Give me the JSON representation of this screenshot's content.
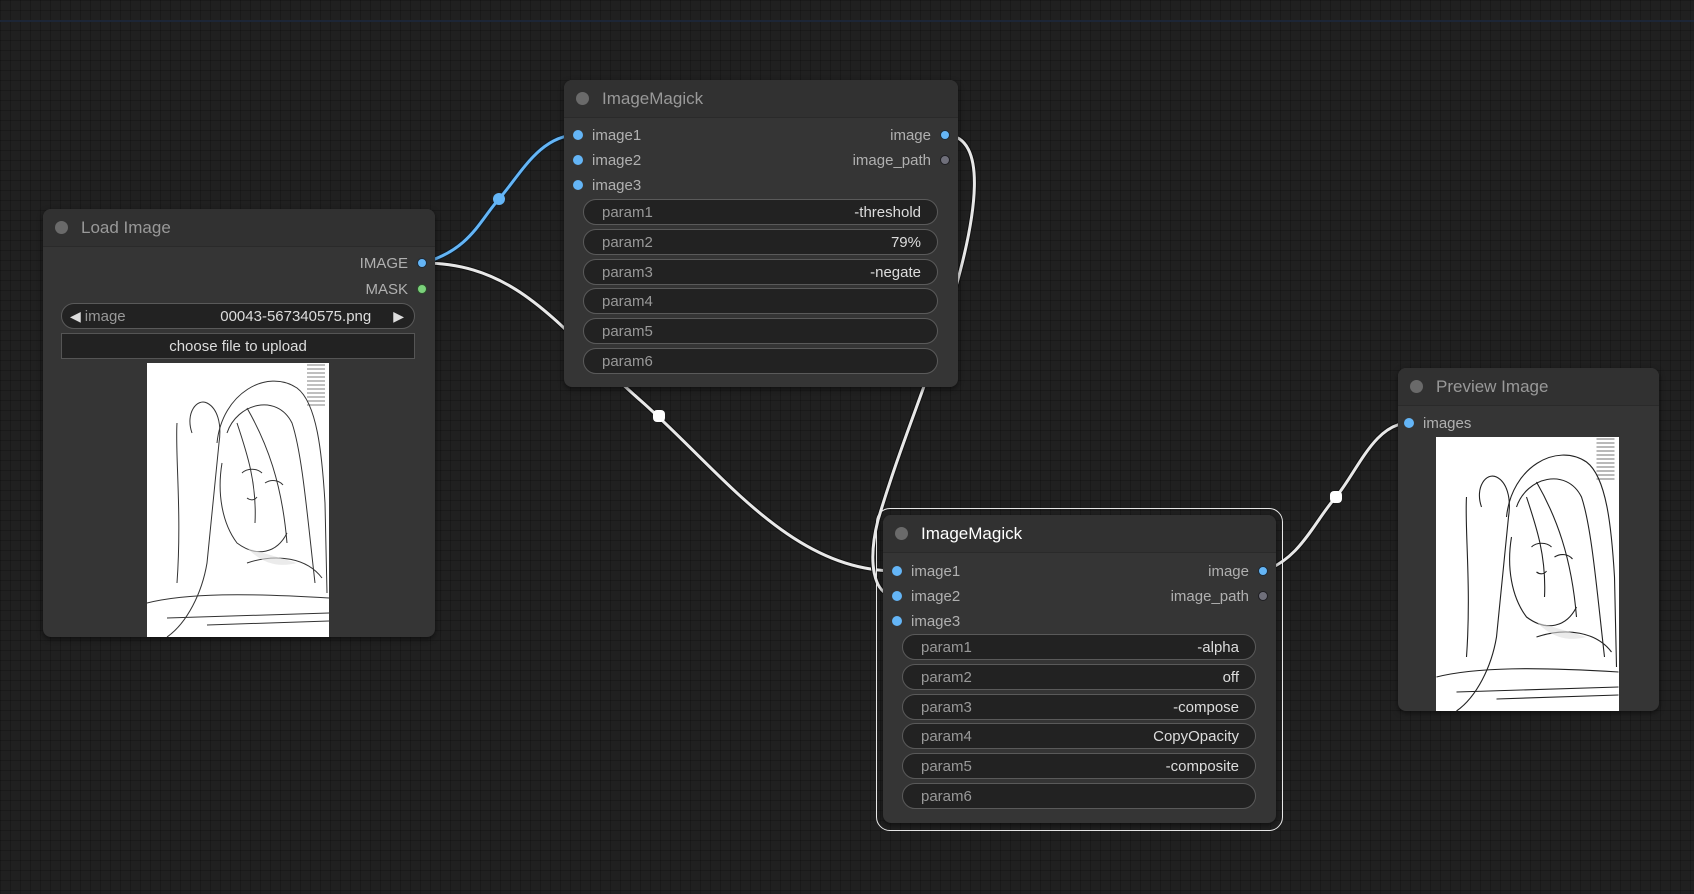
{
  "canvas": {
    "background": "#202020",
    "link_colors": {
      "image": "#64b5f6",
      "default": "#e8e8e8"
    }
  },
  "nodes": {
    "load_image": {
      "title": "Load Image",
      "outputs": [
        {
          "name": "IMAGE",
          "color": "blue"
        },
        {
          "name": "MASK",
          "color": "green"
        }
      ],
      "image_combo": {
        "label": "image",
        "value": "00043-567340575.png",
        "prev_icon": "◀",
        "next_icon": "▶"
      },
      "upload_button": "choose file to upload",
      "preview_alt": "line-art illustration of a long-haired girl"
    },
    "imagemagick_1": {
      "title": "ImageMagick",
      "inputs": [
        "image1",
        "image2",
        "image3"
      ],
      "outputs": [
        "image",
        "image_path"
      ],
      "params": [
        {
          "label": "param1",
          "value": "-threshold"
        },
        {
          "label": "param2",
          "value": "79%"
        },
        {
          "label": "param3",
          "value": "-negate"
        },
        {
          "label": "param4",
          "value": ""
        },
        {
          "label": "param5",
          "value": ""
        },
        {
          "label": "param6",
          "value": ""
        }
      ]
    },
    "imagemagick_2": {
      "title": "ImageMagick",
      "selected": true,
      "inputs": [
        "image1",
        "image2",
        "image3"
      ],
      "outputs": [
        "image",
        "image_path"
      ],
      "params": [
        {
          "label": "param1",
          "value": "-alpha"
        },
        {
          "label": "param2",
          "value": "off"
        },
        {
          "label": "param3",
          "value": "-compose"
        },
        {
          "label": "param4",
          "value": "CopyOpacity"
        },
        {
          "label": "param5",
          "value": "-composite"
        },
        {
          "label": "param6",
          "value": ""
        }
      ]
    },
    "preview_image": {
      "title": "Preview Image",
      "inputs": [
        "images"
      ],
      "preview_alt": "processed line-art illustration of a long-haired girl"
    }
  },
  "links": [
    {
      "from": "Load Image.IMAGE",
      "to": "ImageMagick(1).image1",
      "type": "image"
    },
    {
      "from": "Load Image.IMAGE",
      "to": "ImageMagick(2).image1",
      "type": "default"
    },
    {
      "from": "ImageMagick(1).image",
      "to": "ImageMagick(2).image2",
      "type": "default"
    },
    {
      "from": "ImageMagick(2).image",
      "to": "Preview Image.images",
      "type": "default"
    }
  ]
}
